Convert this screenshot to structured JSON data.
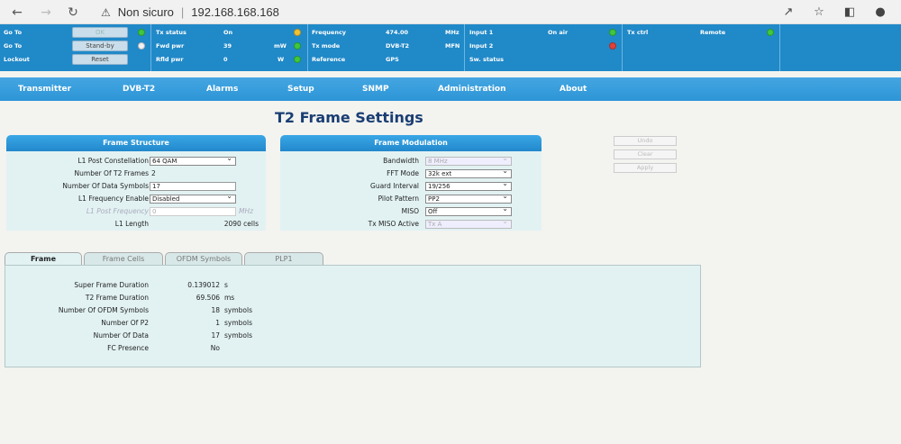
{
  "browser": {
    "security_label": "Non sicuro",
    "url": "192.168.168.168"
  },
  "status": {
    "col1": [
      {
        "key": "Go To",
        "button": "OK",
        "led": "#3ec83e"
      },
      {
        "key": "Go To",
        "button": "Stand-by",
        "led": "#f2f2f2"
      },
      {
        "key": "Lockout",
        "button": "Reset"
      }
    ],
    "col2": [
      {
        "key": "Tx status",
        "value": "On",
        "unit": "",
        "led": "#f1c232"
      },
      {
        "key": "Fwd pwr",
        "value": "39",
        "unit": "mW",
        "led": "#3ec83e"
      },
      {
        "key": "Rfld pwr",
        "value": "0",
        "unit": "W",
        "led": "#3ec83e"
      }
    ],
    "col3": [
      {
        "key": "Frequency",
        "value": "474.00",
        "unit": "MHz"
      },
      {
        "key": "Tx mode",
        "value": "DVB-T2",
        "unit": "MFN"
      },
      {
        "key": "Reference",
        "value": "GPS",
        "unit": ""
      }
    ],
    "col4": [
      {
        "key": "Input 1",
        "value": "On air",
        "led": "#3ec83e"
      },
      {
        "key": "Input 2",
        "value": "",
        "led": "#e0403a"
      },
      {
        "key": "Sw. status",
        "value": ""
      }
    ],
    "col5": {
      "key": "Tx ctrl",
      "value": "Remote",
      "led": "#3ec83e"
    }
  },
  "nav": [
    "Transmitter",
    "DVB-T2",
    "Alarms",
    "Setup",
    "SNMP",
    "Administration",
    "About"
  ],
  "page_title": "T2 Frame Settings",
  "frame_structure": {
    "title": "Frame Structure",
    "l1_post_constellation": {
      "label": "L1 Post Constellation",
      "value": "64 QAM"
    },
    "num_t2_frames": {
      "label": "Number Of T2 Frames",
      "value": "2"
    },
    "num_data_symbols": {
      "label": "Number Of Data Symbols",
      "value": "17"
    },
    "l1_freq_enable": {
      "label": "L1 Frequency Enable",
      "value": "Disabled"
    },
    "l1_post_frequency": {
      "label": "L1 Post Frequency",
      "value": "0",
      "unit": "MHz"
    },
    "l1_length": {
      "label": "L1 Length",
      "value": "2090 cells"
    }
  },
  "frame_modulation": {
    "title": "Frame Modulation",
    "bandwidth": {
      "label": "Bandwidth",
      "value": "8 MHz"
    },
    "fft_mode": {
      "label": "FFT Mode",
      "value": "32k ext"
    },
    "guard_interval": {
      "label": "Guard Interval",
      "value": "19/256"
    },
    "pilot_pattern": {
      "label": "Pilot Pattern",
      "value": "PP2"
    },
    "miso": {
      "label": "MISO",
      "value": "Off"
    },
    "tx_miso_active": {
      "label": "Tx MISO Active",
      "value": "Tx A"
    }
  },
  "actions": {
    "undo": "Undo",
    "clear": "Clear",
    "apply": "Apply"
  },
  "tabs": [
    "Frame",
    "Frame Cells",
    "OFDM Symbols",
    "PLP1"
  ],
  "frame_info": [
    {
      "label": "Super Frame Duration",
      "value": "0.139012",
      "unit": "s"
    },
    {
      "label": "T2 Frame Duration",
      "value": "69.506",
      "unit": "ms"
    },
    {
      "label": "Number Of OFDM Symbols",
      "value": "18",
      "unit": "symbols"
    },
    {
      "label": "Number Of P2",
      "value": "1",
      "unit": "symbols"
    },
    {
      "label": "Number Of Data",
      "value": "17",
      "unit": "symbols"
    },
    {
      "label": "FC Presence",
      "value": "No",
      "unit": ""
    }
  ]
}
